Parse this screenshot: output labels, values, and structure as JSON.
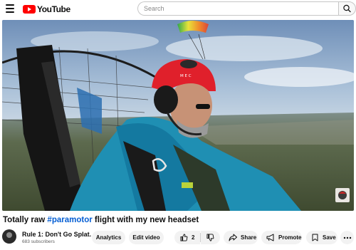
{
  "header": {
    "logo_text": "YouTube",
    "search_placeholder": "Search",
    "icons": [
      "menu-icon",
      "youtube-logo-icon",
      "search-icon"
    ]
  },
  "video": {
    "title_prefix": "Totally raw ",
    "title_hashtag": "#paramotor",
    "title_suffix": " flight with my new headset",
    "helmet_text": "M E C",
    "description_of_scene": ""
  },
  "channel": {
    "name": "Rule 1: Don't Go Splat.",
    "subscribers": "683 subscribers"
  },
  "actions": {
    "analytics_label": "Analytics",
    "edit_label": "Edit video",
    "like_count": "2",
    "share_label": "Share",
    "promote_label": "Promote",
    "save_label": "Save"
  },
  "colors": {
    "brand_red": "#ff0000",
    "hashtag_blue": "#065fd4",
    "pill_bg": "#f2f2f2"
  }
}
